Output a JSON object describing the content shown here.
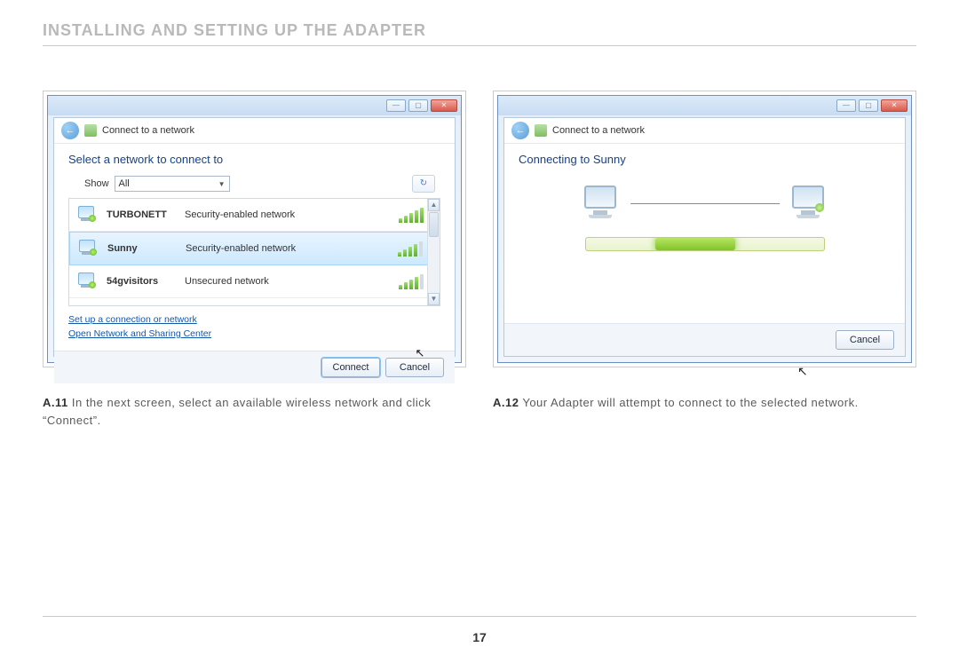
{
  "page": {
    "section_title": "INSTALLING AND SETTING UP THE ADAPTER",
    "number": "17"
  },
  "left": {
    "window_title": "Connect to a network",
    "instruction": "Select a network to connect to",
    "show_label": "Show",
    "show_value": "All",
    "networks": [
      {
        "name": "TURBONETT",
        "desc": "Security-enabled network",
        "selected": false,
        "bars": 5
      },
      {
        "name": "Sunny",
        "desc": "Security-enabled network",
        "selected": true,
        "bars": 4
      },
      {
        "name": "54gvisitors",
        "desc": "Unsecured network",
        "selected": false,
        "bars": 4
      }
    ],
    "link1": "Set up a connection or network",
    "link2": "Open Network and Sharing Center",
    "btn_connect": "Connect",
    "btn_cancel": "Cancel",
    "caption_num": "A.11",
    "caption_text": " In the next screen, select an available wireless network and click “Connect”."
  },
  "right": {
    "window_title": "Connect to a network",
    "instruction": "Connecting to Sunny",
    "btn_cancel": "Cancel",
    "caption_num": "A.12",
    "caption_text": " Your Adapter will attempt to connect to the selected network."
  }
}
